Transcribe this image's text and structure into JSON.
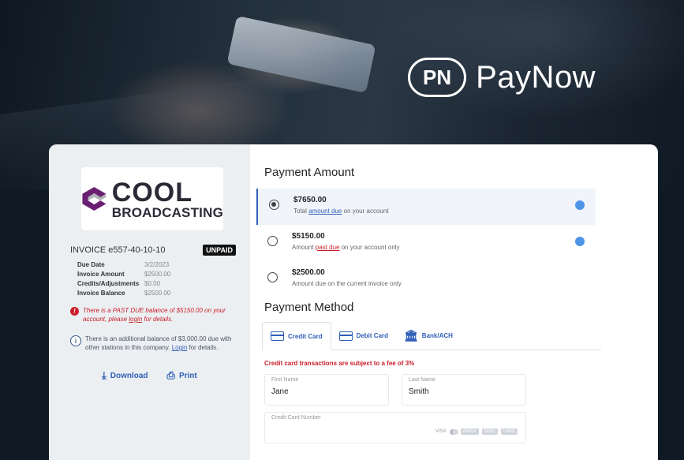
{
  "brand": {
    "mark": "PN",
    "name": "PayNow"
  },
  "company": {
    "line1": "COOL",
    "line2": "BROADCASTING"
  },
  "invoice": {
    "number": "INVOICE e557-40-10-10",
    "status": "UNPAID",
    "rows": [
      {
        "label": "Due Date",
        "value": "3/2/2023"
      },
      {
        "label": "Invoice Amount",
        "value": "$2500.00"
      },
      {
        "label": "Credits/Adjustments",
        "value": "$0.00"
      },
      {
        "label": "Invoice Balance",
        "value": "$2500.00"
      }
    ]
  },
  "alerts": {
    "past_due": {
      "text_before": "There is a PAST DUE balance of $5150.00 on your account, please ",
      "link": "login",
      "text_after": " for details."
    },
    "additional": {
      "text_before": "There is an additional balance of $3,000.00 due with other stations in this company. ",
      "link": "Login",
      "text_after": " for details."
    }
  },
  "actions": {
    "download": "Download",
    "print": "Print"
  },
  "payment_amount": {
    "title": "Payment Amount",
    "options": [
      {
        "amount": "$7650.00",
        "desc_before": "Total ",
        "desc_link": "amount due",
        "desc_after": " on your account",
        "selected": true
      },
      {
        "amount": "$5150.00",
        "desc_before": "Amount ",
        "desc_link": "past due",
        "desc_after": " on your account only",
        "selected": false
      },
      {
        "amount": "$2500.00",
        "desc_before": "Amount due on the current invoice only",
        "desc_link": "",
        "desc_after": "",
        "selected": false
      }
    ]
  },
  "payment_method": {
    "title": "Payment Method",
    "tabs": [
      "Credit Card",
      "Debit Card",
      "Bank/ACH"
    ],
    "fee_notice": "Credit card transactions are subject to a fee of 3%",
    "first_name": {
      "label": "First Name",
      "value": "Jane"
    },
    "last_name": {
      "label": "Last Name",
      "value": "Smith"
    },
    "card_number": {
      "label": "Credit Card Number"
    },
    "card_brands": [
      "VISA",
      "mastercard",
      "AMEX",
      "DISC",
      "UNIO"
    ]
  },
  "colors": {
    "accent": "#2f5fb8",
    "alert": "#c8202a",
    "dot": "#4e95e8",
    "sidebar_bg": "#eceff2"
  }
}
